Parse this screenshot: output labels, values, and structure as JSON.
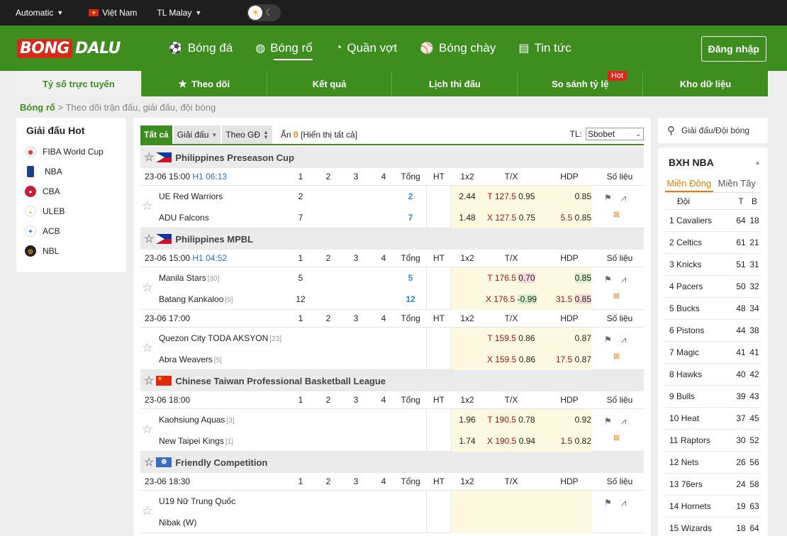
{
  "topbar": {
    "auto": "Automatic",
    "country": "Việt Nam",
    "odds": "TL Malay"
  },
  "header": {
    "logo1": "BONG",
    "logo2": "DALU",
    "nav": [
      {
        "label": "Bóng đá",
        "icon": "soccer-icon"
      },
      {
        "label": "Bóng rổ",
        "icon": "basketball-icon"
      },
      {
        "label": "Quần vợt",
        "icon": "tennis-icon"
      },
      {
        "label": "Bóng chày",
        "icon": "baseball-icon"
      },
      {
        "label": "Tin tức",
        "icon": "news-icon"
      }
    ],
    "login": "Đăng nhập"
  },
  "subnav": [
    "Tỷ số trực tuyến",
    "Theo dõi",
    "Kết quả",
    "Lịch thi đấu",
    "So sánh tỷ lệ",
    "Kho dữ liệu"
  ],
  "hot_badge": "Hot",
  "breadcrumb": {
    "root": "Bóng rổ",
    "sep": ">",
    "desc": "Theo dõi trận đấu, giải đấu, đội bóng"
  },
  "hot_leagues": {
    "title": "Giải đấu Hot",
    "items": [
      "FIBA World Cup",
      "NBA",
      "CBA",
      "ULEB",
      "ACB",
      "NBL"
    ]
  },
  "filters": {
    "all": "Tất cả",
    "league": "Giải đấu",
    "by": "Theo GĐ",
    "hide_prefix": "Ẩn",
    "hide_count": "0",
    "show_all": "[Hiển thị tất cả]",
    "tl_label": "TL:",
    "bookmaker": "Sbobet"
  },
  "cols": {
    "q1": "1",
    "q2": "2",
    "q3": "3",
    "q4": "4",
    "total": "Tổng",
    "ht": "HT",
    "x12": "1x2",
    "tx": "T/X",
    "hdp": "HDP",
    "stats": "Số liệu"
  },
  "leagues": [
    {
      "name": "Philippines Preseason Cup",
      "flag": "ph",
      "matches": [
        {
          "time": "23-06 15:00",
          "status": "H1 06:13",
          "home": {
            "name": "UE Red Warriors",
            "rank": "",
            "q1": "2",
            "total": "2",
            "x12": "2.44",
            "tx_t": "T",
            "tx_v": "127.5",
            "tx_o": "0.95",
            "hdp_l": "",
            "hdp_o": "0.85"
          },
          "away": {
            "name": "ADU Falcons",
            "rank": "",
            "q1": "7",
            "total": "7",
            "x12": "1.48",
            "tx_t": "X",
            "tx_v": "127.5",
            "tx_o": "0.75",
            "hdp_l": "5.5",
            "hdp_o": "0.85"
          }
        }
      ]
    },
    {
      "name": "Philippines MPBL",
      "flag": "ph",
      "matches": [
        {
          "time": "23-06 15:00",
          "status": "H1 04:52",
          "home": {
            "name": "Manila Stars",
            "rank": "[30]",
            "q1": "5",
            "total": "5",
            "x12": "",
            "tx_t": "T",
            "tx_v": "176.5",
            "tx_o": "0.70",
            "hdp_l": "",
            "hdp_o": "0.85"
          },
          "away": {
            "name": "Batang Kankaloo",
            "rank": "[9]",
            "q1": "12",
            "total": "12",
            "x12": "",
            "tx_t": "X",
            "tx_v": "176.5",
            "tx_o": "-0.99",
            "hdp_l": "31.5",
            "hdp_o": "0.85"
          }
        },
        {
          "time": "23-06 17:00",
          "status": "",
          "home": {
            "name": "Quezon City TODA AKSYON",
            "rank": "[23]",
            "q1": "",
            "total": "",
            "x12": "",
            "tx_t": "T",
            "tx_v": "159.5",
            "tx_o": "0.86",
            "hdp_l": "",
            "hdp_o": "0.87"
          },
          "away": {
            "name": "Abra Weavers",
            "rank": "[5]",
            "q1": "",
            "total": "",
            "x12": "",
            "tx_t": "X",
            "tx_v": "159.5",
            "tx_o": "0.86",
            "hdp_l": "17.5",
            "hdp_o": "0.87"
          }
        }
      ]
    },
    {
      "name": "Chinese Taiwan Professional Basketball League",
      "flag": "cn",
      "matches": [
        {
          "time": "23-06 18:00",
          "status": "",
          "home": {
            "name": "Kaohsiung Aquas",
            "rank": "[3]",
            "q1": "",
            "total": "",
            "x12": "1.96",
            "tx_t": "T",
            "tx_v": "190.5",
            "tx_o": "0.78",
            "hdp_l": "",
            "hdp_o": "0.92"
          },
          "away": {
            "name": "New Taipei Kings",
            "rank": "[1]",
            "q1": "",
            "total": "",
            "x12": "1.74",
            "tx_t": "X",
            "tx_v": "190.5",
            "tx_o": "0.94",
            "hdp_l": "1.5",
            "hdp_o": "0.82"
          }
        }
      ]
    },
    {
      "name": "Friendly Competition",
      "flag": "wd",
      "matches": [
        {
          "time": "23-06 18:30",
          "status": "",
          "home": {
            "name": "U19 Nữ Trung Quốc",
            "rank": "",
            "q1": "",
            "total": "",
            "x12": "",
            "tx_t": "",
            "tx_v": "",
            "tx_o": "",
            "hdp_l": "",
            "hdp_o": ""
          },
          "away": {
            "name": "Nibak (W)",
            "rank": "",
            "q1": "",
            "total": "",
            "x12": "",
            "tx_t": "",
            "tx_v": "",
            "tx_o": "",
            "hdp_l": "",
            "hdp_o": ""
          }
        }
      ]
    }
  ],
  "search": {
    "label": "Giải đấu/Đội bóng"
  },
  "standings": {
    "title": "BXH NBA",
    "tabs": [
      "Miền Đông",
      "Miền Tây"
    ],
    "head": {
      "team": "Đội",
      "w": "T",
      "l": "B"
    },
    "rows": [
      {
        "pos": "1",
        "team": "Cavaliers",
        "w": "64",
        "l": "18"
      },
      {
        "pos": "2",
        "team": "Celtics",
        "w": "61",
        "l": "21"
      },
      {
        "pos": "3",
        "team": "Knicks",
        "w": "51",
        "l": "31"
      },
      {
        "pos": "4",
        "team": "Pacers",
        "w": "50",
        "l": "32"
      },
      {
        "pos": "5",
        "team": "Bucks",
        "w": "48",
        "l": "34"
      },
      {
        "pos": "6",
        "team": "Pistons",
        "w": "44",
        "l": "38"
      },
      {
        "pos": "7",
        "team": "Magic",
        "w": "41",
        "l": "41"
      },
      {
        "pos": "8",
        "team": "Hawks",
        "w": "40",
        "l": "42"
      },
      {
        "pos": "9",
        "team": "Bulls",
        "w": "39",
        "l": "43"
      },
      {
        "pos": "10",
        "team": "Heat",
        "w": "37",
        "l": "45"
      },
      {
        "pos": "11",
        "team": "Raptors",
        "w": "30",
        "l": "52"
      },
      {
        "pos": "12",
        "team": "Nets",
        "w": "26",
        "l": "56"
      },
      {
        "pos": "13",
        "team": "76ers",
        "w": "24",
        "l": "58"
      },
      {
        "pos": "14",
        "team": "Hornets",
        "w": "19",
        "l": "63"
      },
      {
        "pos": "15",
        "team": "Wizards",
        "w": "18",
        "l": "64"
      }
    ]
  }
}
